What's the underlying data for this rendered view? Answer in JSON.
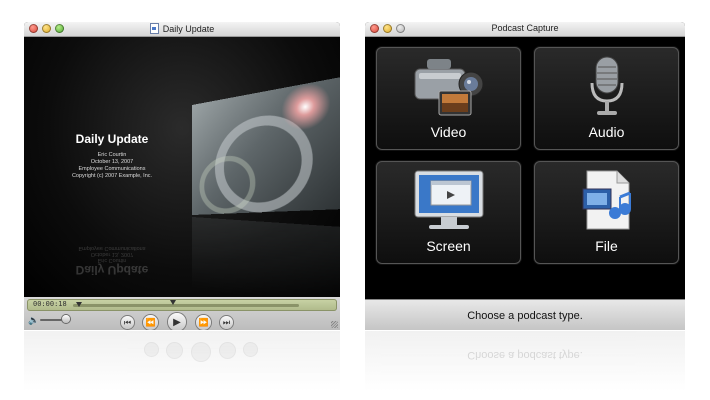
{
  "player": {
    "title": "Daily Update",
    "slide": {
      "title": "Daily Update",
      "lines": [
        "Eric Courtin",
        "October 13, 2007",
        "Employee Communications",
        "Copyright (c) 2007 Example, Inc."
      ]
    },
    "timecode": "00:00:18",
    "volume_icon": "speaker-icon",
    "buttons": [
      "skip-back-icon",
      "rewind-icon",
      "play-icon",
      "fast-forward-icon",
      "skip-forward-icon"
    ]
  },
  "capture": {
    "title": "Podcast Capture",
    "tiles": [
      {
        "label": "Video",
        "icon": "video-camera-icon"
      },
      {
        "label": "Audio",
        "icon": "microphone-icon"
      },
      {
        "label": "Screen",
        "icon": "monitor-icon"
      },
      {
        "label": "File",
        "icon": "media-file-icon"
      }
    ],
    "status": "Choose a podcast type."
  }
}
